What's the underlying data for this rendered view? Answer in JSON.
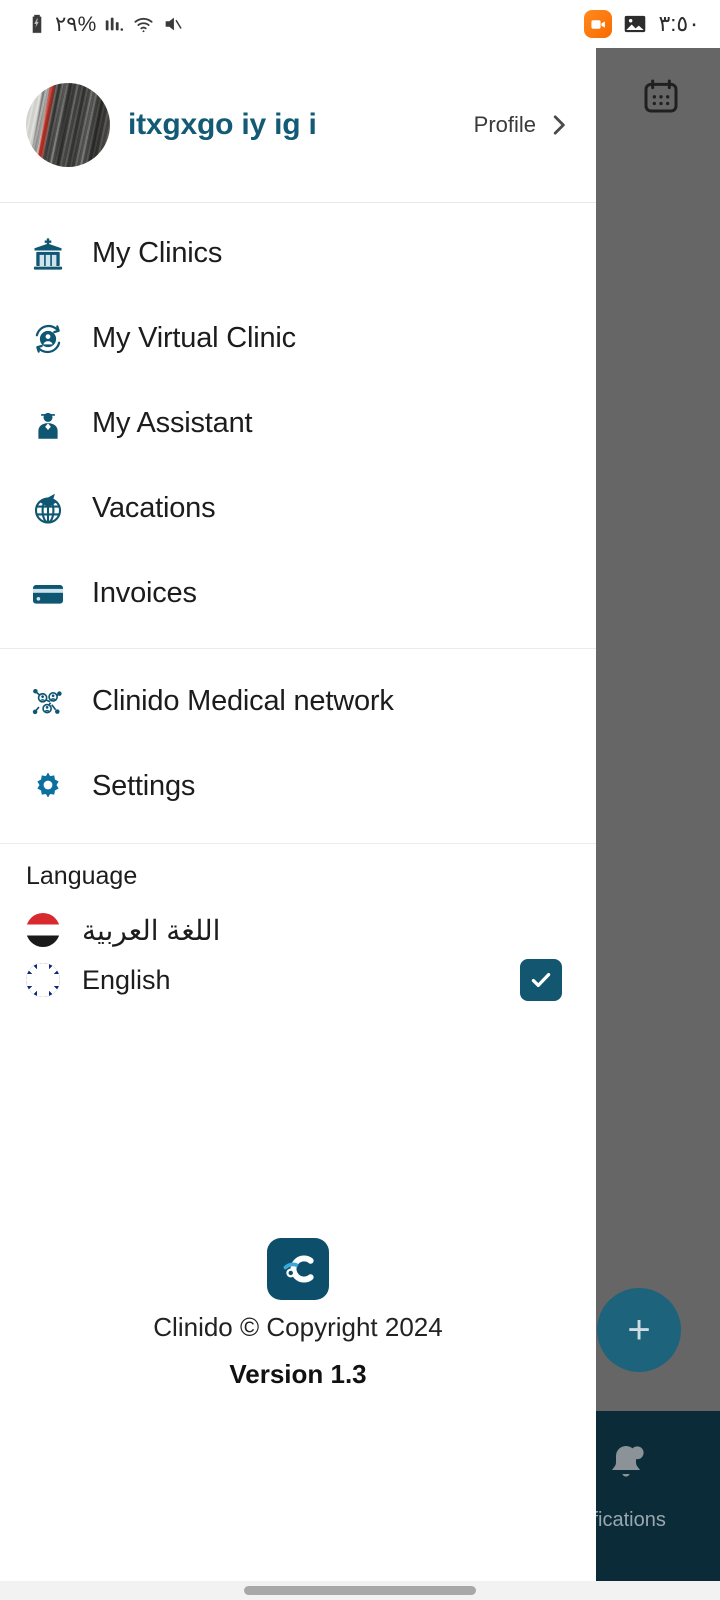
{
  "status_bar": {
    "battery_text": "٢٩%",
    "battery_icon": "battery-charging-icon",
    "signal_icon": "cellular-signal-icon",
    "wifi_icon": "wifi-icon",
    "mute_icon": "mute-icon",
    "screen_record_icon": "screen-recorder-icon",
    "photo_icon": "photo-icon",
    "time": "٣:٥٠"
  },
  "profile": {
    "name": "itxgxgo iy ig i",
    "link_label": "Profile",
    "chevron_icon": "chevron-right-icon",
    "avatar_icon": "avatar"
  },
  "menu": {
    "group_primary": [
      {
        "label": "My Clinics",
        "icon": "clinic-building-icon"
      },
      {
        "label": "My Virtual Clinic",
        "icon": "virtual-clinic-icon"
      },
      {
        "label": "My Assistant",
        "icon": "assistant-person-icon"
      },
      {
        "label": "Vacations",
        "icon": "globe-plane-icon"
      },
      {
        "label": "Invoices",
        "icon": "credit-card-icon"
      }
    ],
    "group_secondary": [
      {
        "label": "Clinido Medical network",
        "icon": "network-people-icon"
      },
      {
        "label": "Settings",
        "icon": "gear-icon"
      }
    ]
  },
  "language": {
    "title": "Language",
    "options": [
      {
        "label": "اللغة العربية",
        "flag": "egypt-flag-icon",
        "selected": false
      },
      {
        "label": "English",
        "flag": "uk-flag-icon",
        "selected": true
      }
    ],
    "check_icon": "check-icon"
  },
  "footer": {
    "logo_icon": "clinido-logo-icon",
    "copyright": "Clinido © Copyright 2024",
    "version": "Version 1.3"
  },
  "background": {
    "calendar_icon": "calendar-icon",
    "fab_icon": "plus-icon",
    "fab_label": "+",
    "bell_icon": "bell-notification-icon",
    "bottom_label": "ifications"
  },
  "colors": {
    "accent_teal": "#12566f",
    "brand_dark": "#0d4f6b",
    "profile_name": "#135a75",
    "scrim": "#666666",
    "bottom_bar": "#0b2b38",
    "fab": "#1d637c"
  }
}
